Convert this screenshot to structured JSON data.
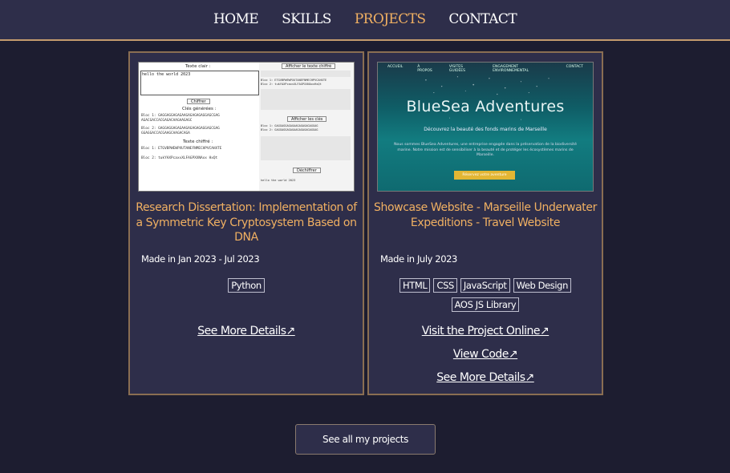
{
  "nav": {
    "items": [
      {
        "label": "HOME"
      },
      {
        "label": "SKILLS"
      },
      {
        "label": "PROJECTS"
      },
      {
        "label": "CONTACT"
      }
    ],
    "active": "PROJECTS",
    "accent_color": "#f0b062"
  },
  "projects": [
    {
      "title": "Research Dissertation: Implementation of a Symmetric Key Cryptosystem Based on DNA",
      "date": "Made in Jan 2023 - Jul 2023",
      "tags": [
        "Python"
      ],
      "links": [
        "See More Details↗"
      ],
      "thumbnail": {
        "plaintext_label": "Texte clair :",
        "plaintext_value": "hello the world 2023",
        "encrypt_button": "Chiffrer",
        "keys_label": "Clés générées :",
        "cipher_label": "Texte chiffré :",
        "show_cipher_button": "Afficher le texte chiffré",
        "show_key_button": "Afficher les clés",
        "decrypt_button": "Déchiffrer",
        "decrypted_text": "hello the world 2023",
        "block_lines": [
          "Bloc 1: GAGGAGGAGAGAAGAGAGAGAGGAGCGAG",
          "AGACGACCACGAGACAAGAAGAGC",
          "Bloc 2: GAGGAGGAGAGAAGAGAGAGAGGAGCGAG",
          "GGAGGACCACGAAGCAAGACAGA",
          "Bloc 1: ETGVBPWEWPXUTANEFNMECHPVCAHXTE",
          "Bloc 2: tukYAXPcaxvXLFAGPXXNAxx HxQt"
        ]
      }
    },
    {
      "title": "Showcase Website - Marseille Underwater Expeditions - Travel Website",
      "date": "Made in July 2023",
      "tags": [
        "HTML",
        "CSS",
        "JavaScript",
        "Web Design",
        "AOS JS Library"
      ],
      "links": [
        "Visit the Project Online↗",
        "View Code↗",
        "See More Details↗"
      ],
      "thumbnail": {
        "nav_items": [
          "ACCUEIL",
          "À PROPOS",
          "VISITES GUIDÉES",
          "ENGAGEMENT ENVIRONNEMENTAL",
          "CONTACT"
        ],
        "brand": "BlueSea Adventures",
        "subtitle": "Découvrez la beauté des fonds marins de Marseille",
        "paragraph": "Nous sommes BlueSea Adventures, une entreprise engagée dans la préservation de la biodiversité marine. Notre mission est de sensibiliser à la beauté et de protéger les écosystèmes marins de Marseille.",
        "cta": "Réservez votre aventure"
      }
    }
  ],
  "see_all_button": "See all my projects",
  "colors": {
    "background": "#1d1d30",
    "surface": "#2e2e4a",
    "border": "#c59b6d",
    "accent": "#f0b062"
  }
}
